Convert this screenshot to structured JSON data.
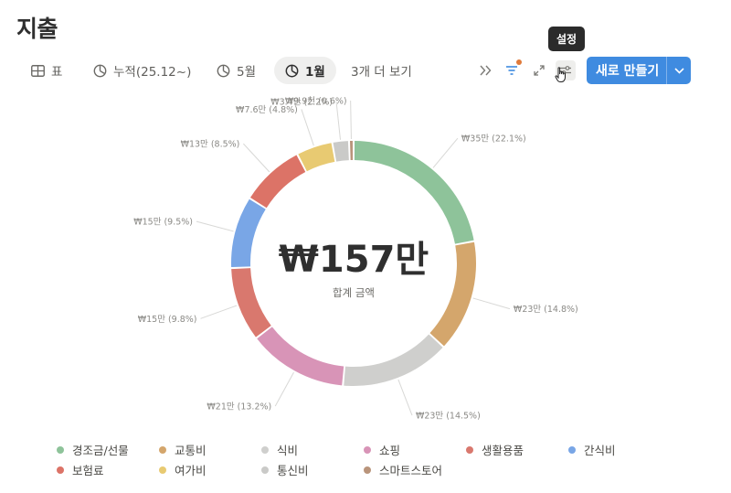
{
  "page": {
    "title": "지출"
  },
  "toolbar": {
    "tabs": [
      {
        "label": "표",
        "icon": "table-icon"
      },
      {
        "label": "누적(25.12~)",
        "icon": "pie-chart-icon"
      },
      {
        "label": "5월",
        "icon": "pie-chart-icon"
      },
      {
        "label": "1월",
        "icon": "pie-chart-icon",
        "active": true
      },
      {
        "label": "3개 더 보기"
      }
    ],
    "tools": [
      "double-chevron-icon",
      "filter-icon",
      "expand-icon",
      "settings-sliders-icon"
    ],
    "tooltip": "설정",
    "new_button": {
      "label": "새로 만들기"
    }
  },
  "colors": {
    "accent": "#3f8be0",
    "tooltip_bg": "#2b2b2b",
    "filter_dot": "#e07a3a"
  },
  "chart_data": {
    "type": "pie",
    "donut": true,
    "center_value": "₩157만",
    "center_label": "합계 금액",
    "slices": [
      {
        "category": "경조금/선물",
        "value_label": "₩35만 (22.1%)",
        "percent": 22.1,
        "color": "#8ec39a"
      },
      {
        "category": "교통비",
        "value_label": "₩23만 (14.8%)",
        "percent": 14.8,
        "color": "#d4a66c"
      },
      {
        "category": "식비",
        "value_label": "₩23만 (14.5%)",
        "percent": 14.5,
        "color": "#cfcfcd"
      },
      {
        "category": "쇼핑",
        "value_label": "₩21만 (13.2%)",
        "percent": 13.2,
        "color": "#d894b7"
      },
      {
        "category": "생활용품",
        "value_label": "₩15만 (9.8%)",
        "percent": 9.8,
        "color": "#d9786e"
      },
      {
        "category": "간식비",
        "value_label": "₩15만 (9.5%)",
        "percent": 9.5,
        "color": "#79a6e6"
      },
      {
        "category": "보험료",
        "value_label": "₩13만 (8.5%)",
        "percent": 8.5,
        "color": "#dc7367"
      },
      {
        "category": "여가비",
        "value_label": "₩7.6만 (4.8%)",
        "percent": 4.8,
        "color": "#e8ca72"
      },
      {
        "category": "통신비",
        "value_label": "₩3.4만 (2.2%)",
        "percent": 2.2,
        "color": "#cacac8"
      },
      {
        "category": "스마트스토어",
        "value_label": "₩9.9천 (0.6%)",
        "percent": 0.6,
        "color": "#b9947b"
      }
    ],
    "legend_position": "bottom"
  }
}
